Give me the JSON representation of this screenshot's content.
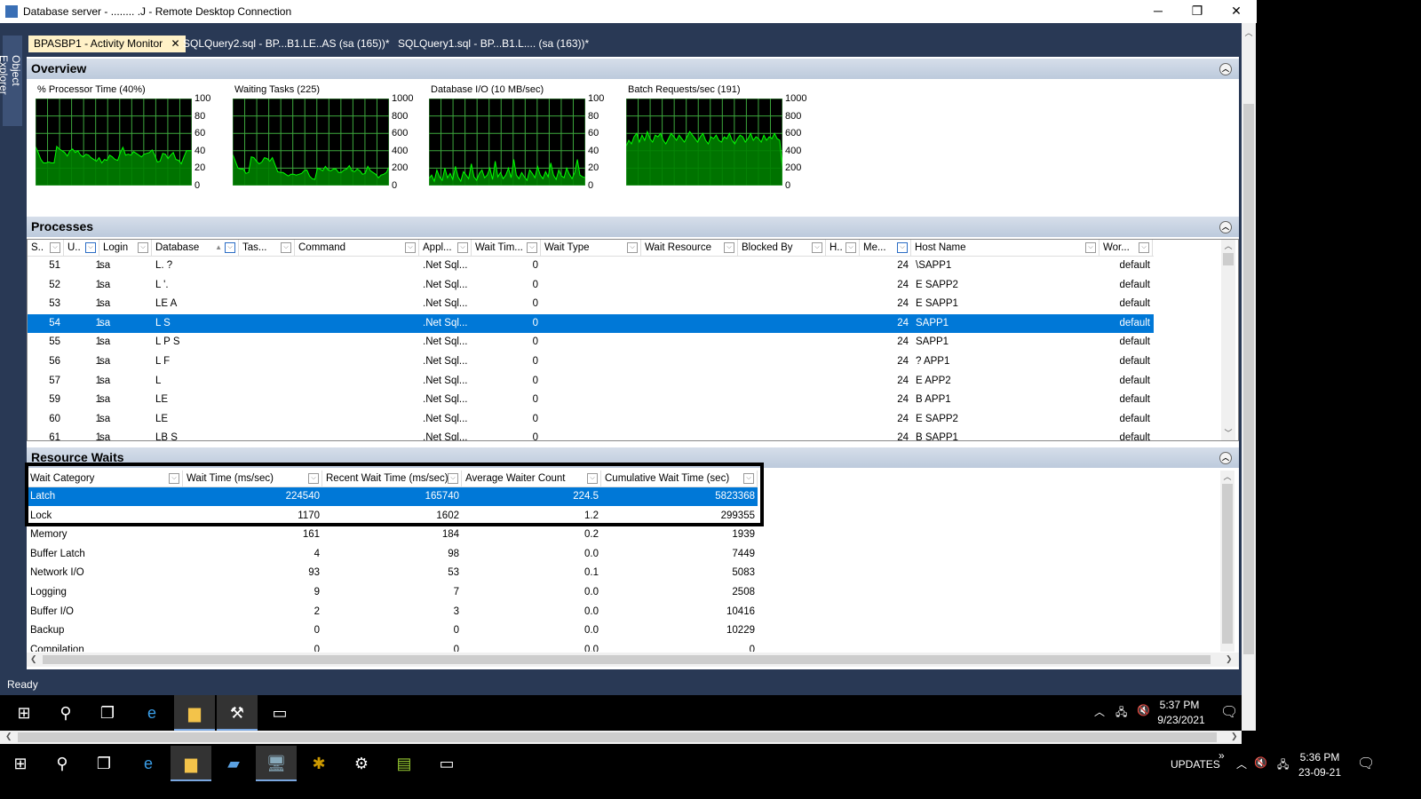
{
  "window": {
    "title": "Database server - ........ .J - Remote Desktop Connection",
    "min": "─",
    "restore": "❐",
    "close": "✕"
  },
  "object_explorer": "Object Explorer",
  "tabs": [
    {
      "label": "BPASBP1 - Activity Monitor",
      "close": "✕",
      "active": true
    },
    {
      "label": "SQLQuery2.sql - BP...B1.LE..AS (sa (165))*"
    },
    {
      "label": "SQLQuery1.sql - BP...B1.L.... (sa (163))*"
    }
  ],
  "overview": {
    "title": "Overview",
    "charts": [
      {
        "title": "% Processor Time (40%)",
        "ticks": [
          "100",
          "80",
          "60",
          "40",
          "20",
          "0"
        ],
        "max": 100,
        "values": [
          45,
          38,
          30,
          26,
          26,
          27,
          26,
          26,
          45,
          42,
          40,
          38,
          34,
          40,
          42,
          38,
          40,
          35,
          33,
          36,
          35,
          32,
          30,
          28,
          32,
          26,
          30,
          29,
          35,
          33,
          30,
          29,
          38,
          44,
          35,
          36,
          35,
          39,
          37,
          35,
          33,
          36,
          37,
          38,
          41,
          35,
          27,
          28,
          37,
          36,
          31,
          35,
          38,
          30,
          29,
          25,
          33,
          40,
          40,
          40
        ]
      },
      {
        "title": "Waiting Tasks (225)",
        "ticks": [
          "1000",
          "800",
          "600",
          "400",
          "200",
          "0"
        ],
        "max": 1000,
        "values": [
          360,
          280,
          200,
          190,
          190,
          140,
          150,
          330,
          320,
          280,
          250,
          270,
          320,
          310,
          280,
          320,
          240,
          160,
          150,
          150,
          130,
          110,
          130,
          130,
          120,
          130,
          140,
          170,
          180,
          110,
          80,
          70,
          200,
          190,
          170,
          220,
          180,
          170,
          190,
          190,
          150,
          150,
          180,
          190,
          230,
          170,
          160,
          190,
          170,
          130,
          140,
          220,
          170,
          150,
          130,
          90,
          120,
          130,
          150,
          210
        ]
      },
      {
        "title": "Database I/O (10 MB/sec)",
        "ticks": [
          "100",
          "80",
          "60",
          "40",
          "20",
          "0"
        ],
        "max": 100,
        "values": [
          8,
          12,
          5,
          18,
          10,
          6,
          20,
          9,
          14,
          7,
          22,
          10,
          5,
          16,
          12,
          8,
          25,
          10,
          6,
          14,
          18,
          9,
          12,
          20,
          7,
          28,
          10,
          15,
          8,
          12,
          20,
          9,
          30,
          12,
          8,
          15,
          10,
          6,
          18,
          14,
          9,
          22,
          12,
          8,
          16,
          10,
          26,
          12,
          7,
          18,
          11,
          9,
          20,
          13,
          8,
          15,
          30,
          12,
          10,
          9
        ]
      },
      {
        "title": "Batch Requests/sec (191)",
        "ticks": [
          "1000",
          "800",
          "600",
          "400",
          "200",
          "0"
        ],
        "max": 1000,
        "values": [
          450,
          520,
          480,
          560,
          600,
          500,
          580,
          520,
          620,
          540,
          500,
          580,
          560,
          600,
          520,
          480,
          540,
          600,
          560,
          520,
          580,
          540,
          500,
          560,
          620,
          580,
          540,
          500,
          560,
          600,
          520,
          480,
          560,
          540,
          580,
          520,
          500,
          560,
          540,
          600,
          520,
          480,
          540,
          580,
          560,
          500,
          540,
          600,
          520,
          560,
          540,
          500,
          580,
          520,
          560,
          540,
          600,
          540,
          520,
          200
        ]
      }
    ]
  },
  "processes": {
    "title": "Processes",
    "columns": [
      "S..",
      "U..",
      "Login",
      "Database",
      "Tas...",
      "Command",
      "Appl...",
      "Wait Tim...",
      "Wait Type",
      "Wait Resource",
      "Blocked By",
      "H..",
      "Me...",
      "Host Name",
      "Wor..."
    ],
    "rows": [
      {
        "s": "51",
        "u": "1",
        "login": "sa",
        "db": "L. ?",
        "app": ".Net Sql...",
        "wt": "0",
        "mem": "24",
        "host": "\\SAPP1",
        "wg": "default"
      },
      {
        "s": "52",
        "u": "1",
        "login": "sa",
        "db": "L '.",
        "app": ".Net Sql...",
        "wt": "0",
        "mem": "24",
        "host": "E  SAPP2",
        "wg": "default"
      },
      {
        "s": "53",
        "u": "1",
        "login": "sa",
        "db": "LE A",
        "app": ".Net Sql...",
        "wt": "0",
        "mem": "24",
        "host": "E  SAPP1",
        "wg": "default"
      },
      {
        "s": "54",
        "u": "1",
        "login": "sa",
        "db": "L  S",
        "app": ".Net Sql...",
        "wt": "0",
        "mem": "24",
        "host": "  SAPP1",
        "wg": "default",
        "selected": true
      },
      {
        "s": "55",
        "u": "1",
        "login": "sa",
        "db": "L P S",
        "app": ".Net Sql...",
        "wt": "0",
        "mem": "24",
        "host": "  SAPP1",
        "wg": "default"
      },
      {
        "s": "56",
        "u": "1",
        "login": "sa",
        "db": "L F",
        "app": ".Net Sql...",
        "wt": "0",
        "mem": "24",
        "host": "?  APP1",
        "wg": "default"
      },
      {
        "s": "57",
        "u": "1",
        "login": "sa",
        "db": "L",
        "app": ".Net Sql...",
        "wt": "0",
        "mem": "24",
        "host": "E  APP2",
        "wg": "default"
      },
      {
        "s": "59",
        "u": "1",
        "login": "sa",
        "db": "LE",
        "app": ".Net Sql...",
        "wt": "0",
        "mem": "24",
        "host": "B  APP1",
        "wg": "default"
      },
      {
        "s": "60",
        "u": "1",
        "login": "sa",
        "db": "LE",
        "app": ".Net Sql...",
        "wt": "0",
        "mem": "24",
        "host": "E  SAPP2",
        "wg": "default"
      },
      {
        "s": "61",
        "u": "1",
        "login": "sa",
        "db": "LB S",
        "app": ".Net Sql...",
        "wt": "0",
        "mem": "24",
        "host": "B  SAPP1",
        "wg": "default"
      }
    ]
  },
  "resource_waits": {
    "title": "Resource Waits",
    "columns": [
      "Wait Category",
      "Wait Time (ms/sec)",
      "Recent Wait Time (ms/sec)",
      "Average Waiter Count",
      "Cumulative Wait Time (sec)"
    ],
    "rows": [
      [
        "Latch",
        "224540",
        "165740",
        "224.5",
        "5823368"
      ],
      [
        "Lock",
        "1170",
        "1602",
        "1.2",
        "299355"
      ],
      [
        "Memory",
        "161",
        "184",
        "0.2",
        "1939"
      ],
      [
        "Buffer Latch",
        "4",
        "98",
        "0.0",
        "7449"
      ],
      [
        "Network I/O",
        "93",
        "53",
        "0.1",
        "5083"
      ],
      [
        "Logging",
        "9",
        "7",
        "0.0",
        "2508"
      ],
      [
        "Buffer I/O",
        "2",
        "3",
        "0.0",
        "10416"
      ],
      [
        "Backup",
        "0",
        "0",
        "0.0",
        "10229"
      ],
      [
        "Compilation",
        "0",
        "0",
        "0.0",
        "0"
      ]
    ],
    "selected_row": 0,
    "highlighted_rows": [
      0,
      1
    ]
  },
  "status": "Ready",
  "remote_taskbar": {
    "time": "5:37 PM",
    "date": "9/23/2021"
  },
  "local_taskbar": {
    "updates": "UPDATES",
    "chevron": "»",
    "time": "5:36 PM",
    "date": "23-09-21"
  },
  "colors": {
    "chart_bg": "#000000",
    "chart_fill": "#008000",
    "chart_line": "#00ff00",
    "grid": "#3da83d",
    "selection": "#0078d7",
    "tab_active": "#fff1c7",
    "ssms_bg": "#293955"
  }
}
